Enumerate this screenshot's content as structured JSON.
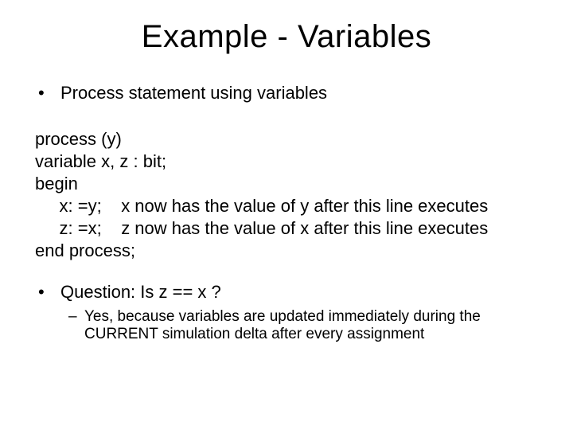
{
  "title": "Example - Variables",
  "bullet1": "Process statement using variables",
  "code": {
    "l1": "process (y)",
    "l2": "variable x, z : bit;",
    "l3": "begin",
    "l4": "     x: =y;    x now has the value of y after this line executes",
    "l5": "     z: =x;    z now has the value of x after this line executes",
    "l6": "end process;"
  },
  "bullet2": "Question: Is z == x ?",
  "sub1": "Yes, because variables are updated immediately during the CURRENT simulation delta after every assignment",
  "glyphs": {
    "dot": "•",
    "dash": "–"
  }
}
